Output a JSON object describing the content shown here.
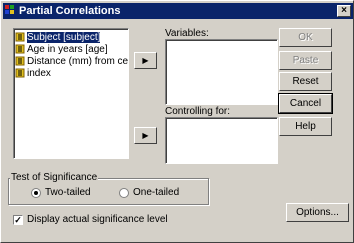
{
  "window": {
    "title": "Partial Correlations",
    "close_glyph": "×"
  },
  "variables_list": {
    "items": [
      {
        "label": "Subject [subject]",
        "selected": true
      },
      {
        "label": "Age in years [age]",
        "selected": false
      },
      {
        "label": "Distance (mm) from cer",
        "selected": false
      },
      {
        "label": "index",
        "selected": false
      }
    ]
  },
  "variables_box": {
    "label": "Variables:"
  },
  "controlling_box": {
    "label": "Controlling for:"
  },
  "arrow_glyph": "▶",
  "buttons": {
    "ok": "OK",
    "paste": "Paste",
    "reset": "Reset",
    "cancel": "Cancel",
    "help": "Help",
    "options": "Options..."
  },
  "significance": {
    "title": "Test of Significance",
    "two_tailed": "Two-tailed",
    "one_tailed": "One-tailed",
    "selected": "two_tailed"
  },
  "display_significance": {
    "label": "Display actual significance level",
    "checked": true,
    "check_glyph": "✓"
  },
  "colors": {
    "title_bar": "#0a246a",
    "dialog_face": "#d4d0c8",
    "selection": "#0a246a"
  }
}
